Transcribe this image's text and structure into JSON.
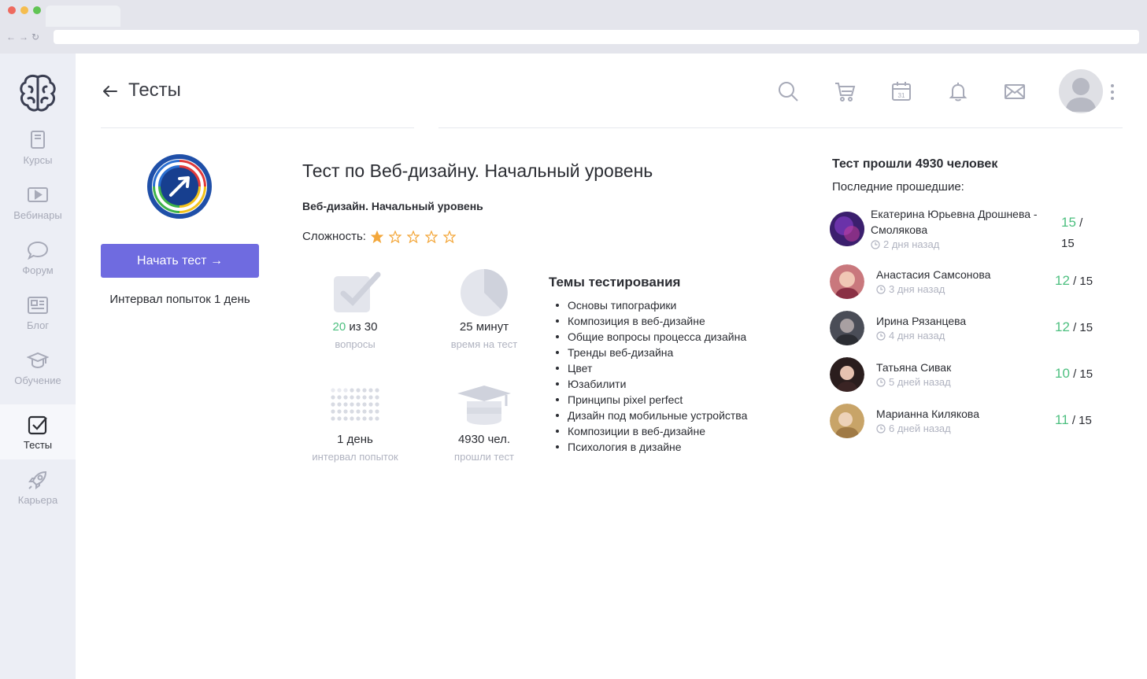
{
  "header": {
    "title": "Тесты",
    "icons": [
      "search-icon",
      "cart-icon",
      "calendar-icon",
      "bell-icon",
      "mail-icon"
    ],
    "calendar_day": "31"
  },
  "sidebar": {
    "items": [
      {
        "label": "Курсы",
        "icon": "book-icon"
      },
      {
        "label": "Вебинары",
        "icon": "play-icon"
      },
      {
        "label": "Форум",
        "icon": "chat-icon"
      },
      {
        "label": "Блог",
        "icon": "news-icon"
      },
      {
        "label": "Обучение",
        "icon": "graduation-cap-icon"
      },
      {
        "label": "Тесты",
        "icon": "checkbox-icon",
        "active": true
      },
      {
        "label": "Карьера",
        "icon": "rocket-icon"
      }
    ]
  },
  "test": {
    "title": "Тест по Веб-дизайну. Начальный уровень",
    "subtitle": "Веб-дизайн. Начальный уровень",
    "difficulty_label": "Сложность:",
    "difficulty_rating": 1,
    "difficulty_max": 5,
    "start_button": "Начать тест →",
    "interval_text": "Интервал попыток 1 день"
  },
  "stats": {
    "questions": {
      "value": "20",
      "rest": " из 30",
      "caption": "вопросы"
    },
    "time": {
      "value": "25 минут",
      "caption": "время на тест"
    },
    "interval": {
      "value": "1 день",
      "caption": "интервал попыток"
    },
    "passed": {
      "value": "4930 чел.",
      "caption": "прошли тест"
    }
  },
  "topics": {
    "title": "Темы тестирования",
    "items": [
      "Основы типографики",
      "Композиция в веб-дизайне",
      "Общие вопросы процесса дизайна",
      "Тренды веб-дизайна",
      "Цвет",
      "Юзабилити",
      "Принципы pixel perfect",
      "Дизайн под мобильные устройства",
      "Композиции в веб-дизайне",
      "Психология в дизайне"
    ]
  },
  "recent": {
    "title": "Тест прошли 4930 человек",
    "label": "Последние прошедшие:",
    "people": [
      {
        "name_line1": "Екатерина Юрьевна Дрошнева -",
        "name_line2": "Смолякова",
        "time": "2 дня назад",
        "score": "15",
        "total": " / ",
        "total2": "15"
      },
      {
        "name_line1": "Анастасия Самсонова",
        "time": "3 дня назад",
        "score": "12",
        "total": " / 15"
      },
      {
        "name_line1": "Ирина Рязанцева",
        "time": "4 дня назад",
        "score": "12",
        "total": " / 15"
      },
      {
        "name_line1": "Татьяна Сивак",
        "time": "5 дней назад",
        "score": "10",
        "total": " / 15"
      },
      {
        "name_line1": "Марианна Килякова",
        "time": "6 дней назад",
        "score": "11",
        "total": " / 15"
      }
    ]
  },
  "colors": {
    "accent": "#6f6be0",
    "score_green": "#4cbf7f",
    "star": "#f3a73b",
    "sidebar_bg": "#eceef5"
  }
}
